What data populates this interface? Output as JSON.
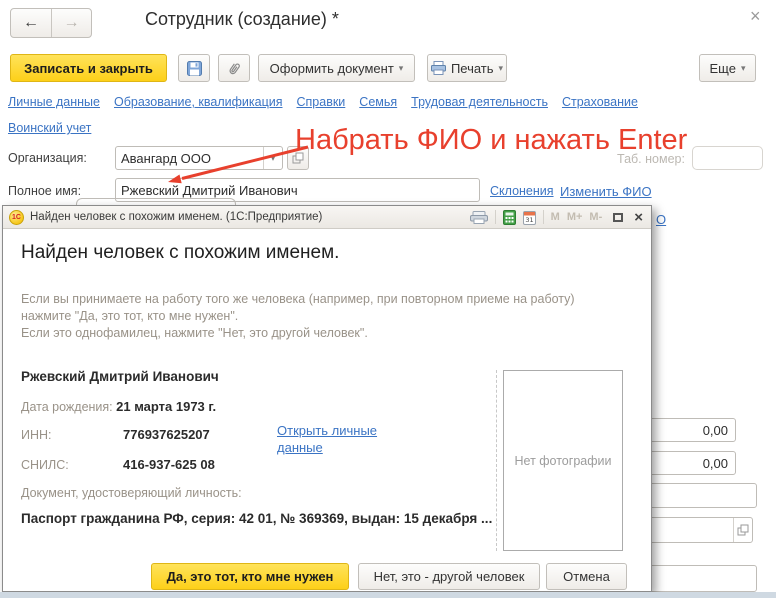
{
  "window": {
    "title": "Сотрудник (создание) *"
  },
  "icons": {
    "back": "←",
    "forward": "→",
    "close": "×",
    "dropdown": "▾",
    "logo_1c": "1С",
    "calendar_day": "31"
  },
  "toolbar": {
    "save_and_close": "Записать и закрыть",
    "issue_document": "Оформить документ",
    "print": "Печать",
    "more": "Еще"
  },
  "nav_tabs": {
    "row1": [
      "Личные данные",
      "Образование, квалификация",
      "Справки",
      "Семья",
      "Трудовая деятельность",
      "Страхование"
    ],
    "row2": [
      "Воинский учет"
    ]
  },
  "form": {
    "organization_label": "Организация:",
    "organization_value": "Авангард ООО",
    "tab_number_label": "Таб. номер:",
    "full_name_label": "Полное имя:",
    "full_name_value": "Ржевский Дмитрий Иванович",
    "declensions_link": "Склонения",
    "change_name_link": "Изменить ФИО",
    "hidden_link_fragment": "О"
  },
  "annotation": {
    "text": "Набрать ФИО и нажать Enter",
    "color": "#e8402d"
  },
  "background_fields": {
    "amount1": "0,00",
    "amount2": "0,00"
  },
  "dialog": {
    "titlebar": {
      "title": "Найден человек с похожим именем.  (1С:Предприятие)",
      "memory_buttons": [
        "M",
        "M+",
        "M-"
      ]
    },
    "heading": "Найден человек с похожим именем.",
    "description_lines": [
      "Если вы принимаете на работу того же человека (например, при повторном приеме на работу)",
      "нажмите \"Да, это тот, кто мне нужен\".",
      "Если это однофамилец, нажмите \"Нет, это другой человек\"."
    ],
    "person": {
      "full_name": "Ржевский Дмитрий Иванович",
      "birth_date_label": "Дата рождения:",
      "birth_date": "21 марта 1973 г.",
      "inn_label": "ИНН:",
      "inn": "776937625207",
      "snils_label": "СНИЛС:",
      "snils": "416-937-625 08",
      "open_personal_data_link": "Открыть личные данные",
      "document_label": "Документ, удостоверяющий личность:",
      "document_value": "Паспорт гражданина РФ, серия: 42 01, № 369369, выдан: 15 декабря ...",
      "no_photo": "Нет фотографии"
    },
    "buttons": {
      "yes": "Да, это тот, кто мне нужен",
      "no": "Нет, это - другой человек",
      "cancel": "Отмена"
    }
  },
  "colors": {
    "accent_yellow": "#fdd019",
    "link_blue": "#3b74c4",
    "annotation_red": "#e8402d"
  }
}
